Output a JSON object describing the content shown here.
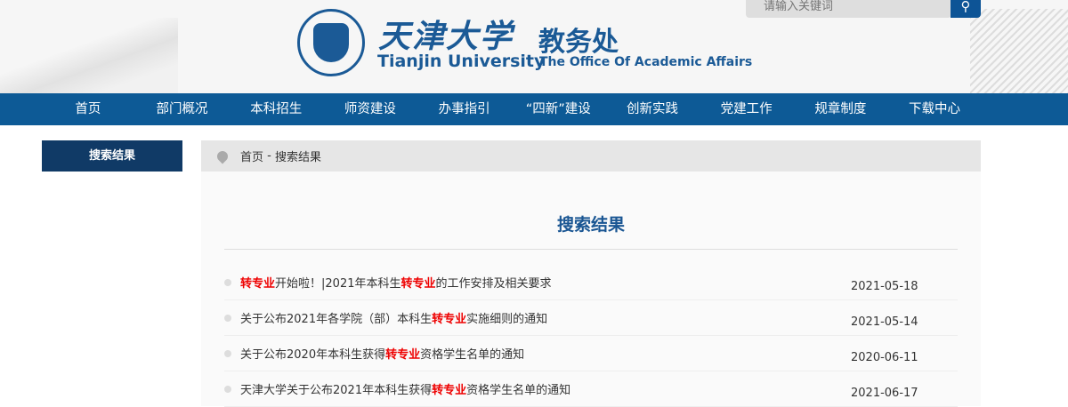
{
  "header": {
    "cn_name": "天津大学",
    "en_name": "Tianjin University",
    "office_cn": "教务处",
    "office_en": "The Office Of Academic Affairs",
    "search_placeholder": "请输入关键词"
  },
  "nav": [
    "首页",
    "部门概况",
    "本科招生",
    "师资建设",
    "办事指引",
    "“四新”建设",
    "创新实践",
    "党建工作",
    "规章制度",
    "下载中心"
  ],
  "sidebar": {
    "title": "搜索结果"
  },
  "breadcrumb": {
    "home": "首页",
    "sep": " - ",
    "current": "搜索结果"
  },
  "main": {
    "title": "搜索结果"
  },
  "results": [
    {
      "parts": [
        [
          "转专业",
          true
        ],
        [
          "开始啦！|2021年本科生",
          false
        ],
        [
          "转专业",
          true
        ],
        [
          "的工作安排及相关要求",
          false
        ]
      ],
      "date": "2021-05-18"
    },
    {
      "parts": [
        [
          "关于公布2021年各学院（部）本科生",
          false
        ],
        [
          "转专业",
          true
        ],
        [
          "实施细则的通知",
          false
        ]
      ],
      "date": "2021-05-14"
    },
    {
      "parts": [
        [
          "关于公布2020年本科生获得",
          false
        ],
        [
          "转专业",
          true
        ],
        [
          "资格学生名单的通知",
          false
        ]
      ],
      "date": "2020-06-11"
    },
    {
      "parts": [
        [
          "天津大学关于公布2021年本科生获得",
          false
        ],
        [
          "转专业",
          true
        ],
        [
          "资格学生名单的通知",
          false
        ]
      ],
      "date": "2021-06-17"
    }
  ]
}
